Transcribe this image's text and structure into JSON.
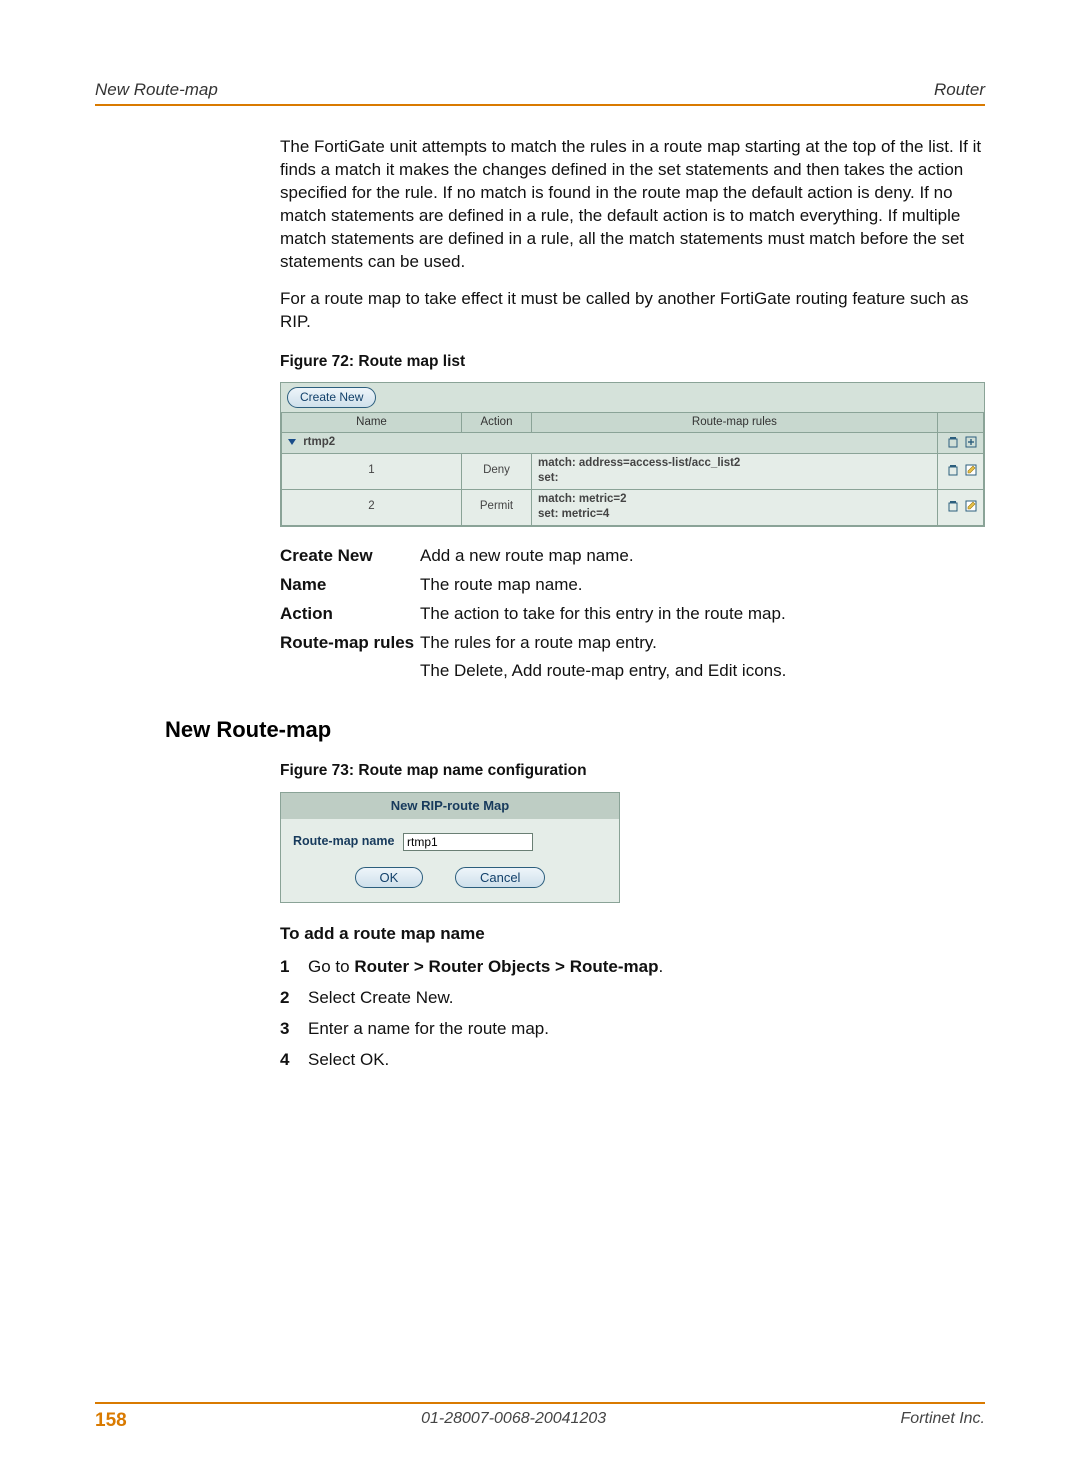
{
  "header": {
    "left": "New Route-map",
    "right": "Router"
  },
  "intro": {
    "p1": "The FortiGate unit attempts to match the rules in a route map starting at the top of the list. If it finds a match it makes the changes defined in the set statements and then takes the action specified for the rule. If no match is found in the route map the default action is deny. If no match statements are defined in a rule, the default action is to match everything. If multiple match statements are defined in a rule, all the match statements must match before the set statements can be used.",
    "p2": "For a route map to take effect it must be called by another FortiGate routing feature such as RIP."
  },
  "fig72": {
    "caption": "Figure 72: Route map list",
    "create_btn": "Create New",
    "cols": {
      "name": "Name",
      "action": "Action",
      "rules": "Route-map rules"
    },
    "group": "rtmp2",
    "rows": [
      {
        "id": "1",
        "action": "Deny",
        "match": "match: address=access-list/acc_list2",
        "set": "set:"
      },
      {
        "id": "2",
        "action": "Permit",
        "match": "match: metric=2",
        "set": "set: metric=4"
      }
    ]
  },
  "defs": {
    "create_new": {
      "term": "Create New",
      "desc": "Add a new route map name."
    },
    "name": {
      "term": "Name",
      "desc": "The route map name."
    },
    "action": {
      "term": "Action",
      "desc": "The action to take for this entry in the route map."
    },
    "rules": {
      "term": "Route-map rules",
      "desc": "The rules for a route map entry."
    },
    "icons_desc": "The Delete, Add route-map entry, and Edit icons."
  },
  "section_heading": "New Route-map",
  "fig73": {
    "caption": "Figure 73: Route map name configuration",
    "title": "New RIP-route Map",
    "label": "Route-map name",
    "value": "rtmp1",
    "ok": "OK",
    "cancel": "Cancel"
  },
  "steps": {
    "title": "To add a route map name",
    "items": [
      {
        "num": "1",
        "pre": "Go to ",
        "bold": "Router > Router Objects > Route-map",
        "post": "."
      },
      {
        "num": "2",
        "text": "Select Create New."
      },
      {
        "num": "3",
        "text": "Enter a name for the route map."
      },
      {
        "num": "4",
        "text": "Select OK."
      }
    ]
  },
  "footer": {
    "page": "158",
    "docid": "01-28007-0068-20041203",
    "company": "Fortinet Inc."
  }
}
